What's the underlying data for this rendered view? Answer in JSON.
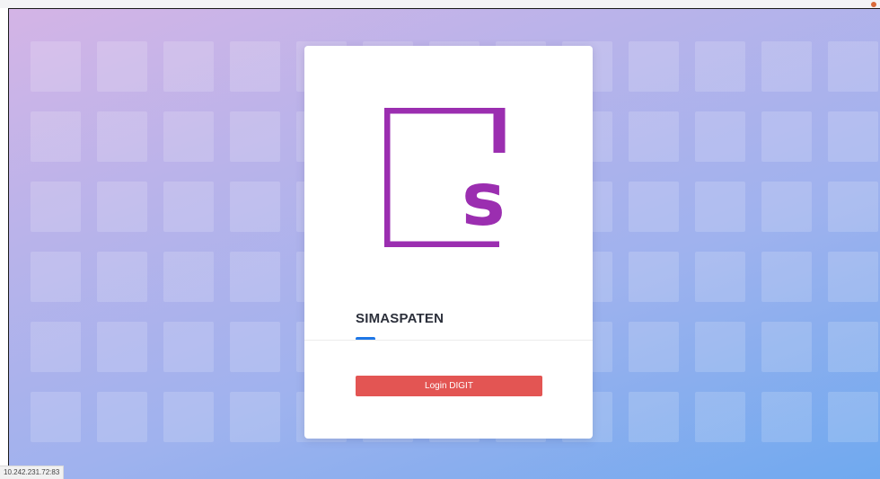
{
  "login_card": {
    "logo_name": "simaspaten-logo",
    "logo_letter": "s",
    "app_title": "SIMASPATEN",
    "login_button_label": "Login DIGIT"
  },
  "status_bar": {
    "url": "10.242.231.72:83"
  },
  "colors": {
    "brand_purple": "#9b2eb0",
    "button_red": "#e35553",
    "accent_blue": "#1f77e6"
  }
}
